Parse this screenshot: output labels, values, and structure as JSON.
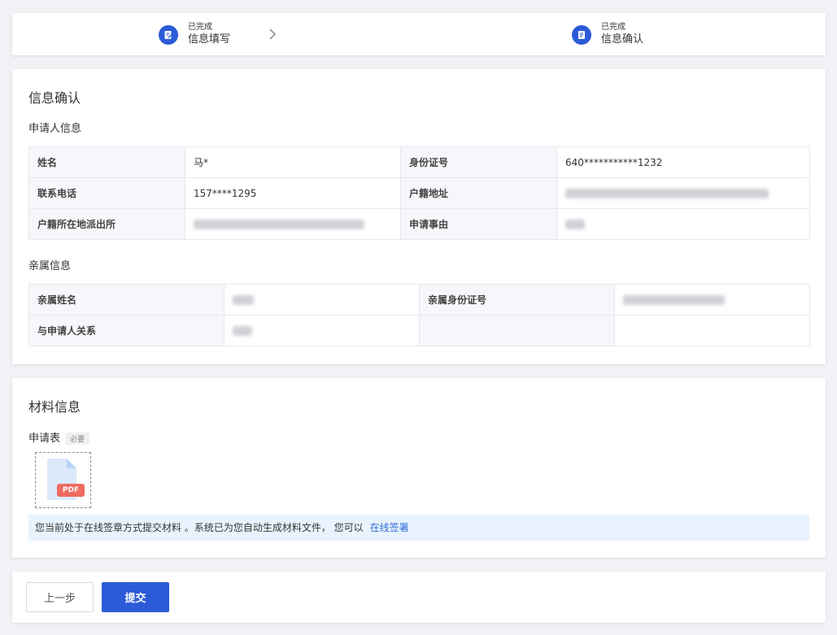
{
  "steps": [
    {
      "status": "已完成",
      "label": "信息填写"
    },
    {
      "status": "已完成",
      "label": "信息确认"
    }
  ],
  "confirm": {
    "title": "信息确认",
    "applicant_heading": "申请人信息",
    "applicant": {
      "name_label": "姓名",
      "name_value": "马*",
      "id_label": "身份证号",
      "id_value": "640***********1232",
      "phone_label": "联系电话",
      "phone_value": "157****1295",
      "household_label": "户籍地址",
      "police_label": "户籍所在地派出所",
      "reason_label": "申请事由"
    },
    "relative_heading": "亲属信息",
    "relative": {
      "name_label": "亲属姓名",
      "id_label": "亲属身份证号",
      "relation_label": "与申请人关系"
    }
  },
  "materials": {
    "title": "材料信息",
    "form_label": "申请表",
    "required_tag": "必要",
    "file_badge": "PDF",
    "notice_text": "您当前处于在线签章方式提交材料 。系统已为您自动生成材料文件， 您可以",
    "notice_link": "在线签署"
  },
  "actions": {
    "prev_label": "上一步",
    "submit_label": "提交"
  },
  "colors": {
    "primary": "#2c5bd8",
    "link": "#2c6bd4",
    "notice_bg": "#e8f3fd",
    "pdf_badge": "#f06a5f"
  }
}
